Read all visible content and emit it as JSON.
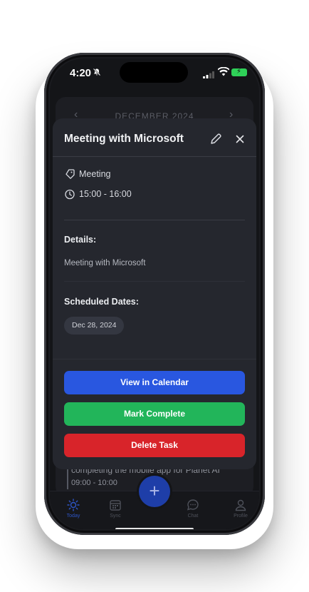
{
  "status_bar": {
    "time": "4:20"
  },
  "background": {
    "month_label": "DECEMBER 2024",
    "task_text": "completing the mobile app for Planet AI",
    "task_time": "09:00 - 10:00"
  },
  "modal": {
    "title": "Meeting with Microsoft",
    "category": "Meeting",
    "time_range": "15:00 - 16:00",
    "details_heading": "Details:",
    "details_text": "Meeting with Microsoft",
    "scheduled_heading": "Scheduled Dates:",
    "scheduled_dates": [
      "Dec 28, 2024"
    ],
    "buttons": {
      "view_calendar": "View in Calendar",
      "mark_complete": "Mark Complete",
      "delete_task": "Delete Task"
    }
  },
  "bottom_nav": {
    "items": [
      {
        "label": "Today",
        "icon": "sun-icon",
        "active": true
      },
      {
        "label": "Sync",
        "icon": "calendar-icon",
        "active": false
      },
      {
        "label": "Chat",
        "icon": "chat-bubble-icon",
        "active": false
      },
      {
        "label": "Profile",
        "icon": "person-icon",
        "active": false
      }
    ],
    "fab_label": "+"
  },
  "colors": {
    "primary_blue": "#2957e0",
    "success_green": "#22b55a",
    "danger_red": "#d8242a",
    "modal_bg": "#25272e"
  }
}
